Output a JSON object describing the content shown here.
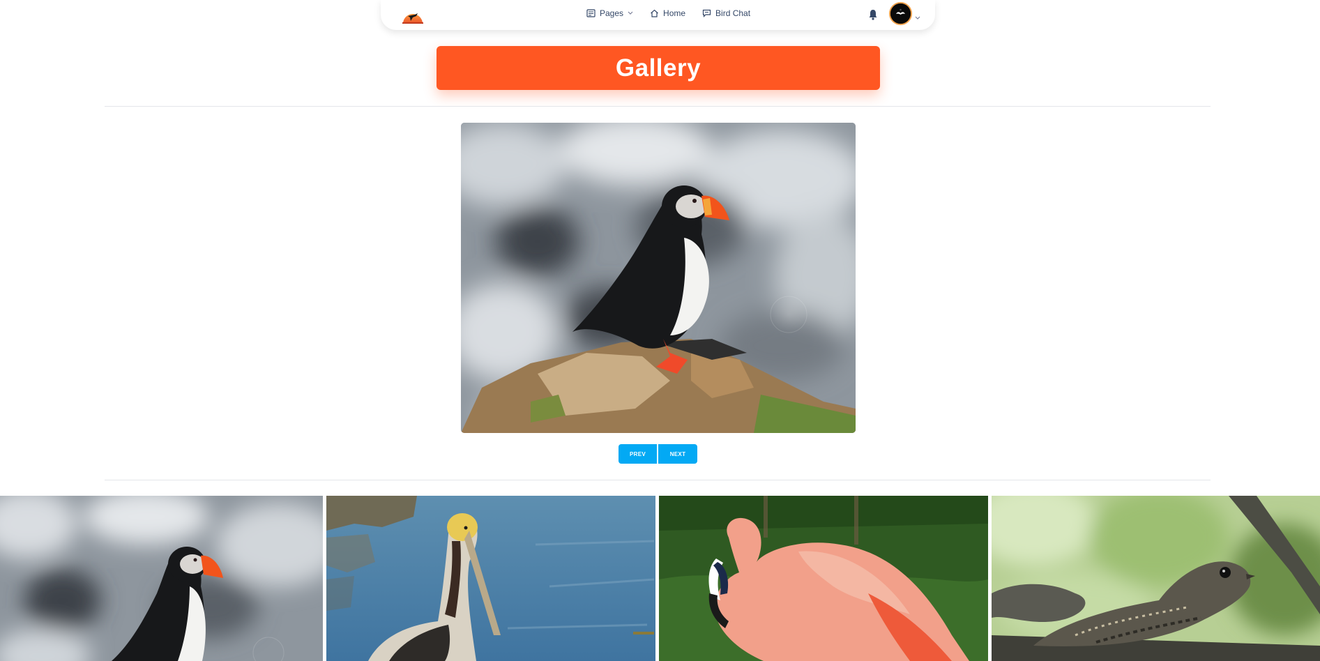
{
  "nav": {
    "pages_label": "Pages",
    "home_label": "Home",
    "chat_label": "Bird Chat"
  },
  "page": {
    "title": "Gallery"
  },
  "controls": {
    "prev_label": "PREV",
    "next_label": "NEXT"
  },
  "gallery": {
    "main_image": "puffin-photo",
    "thumbnails": [
      "puffin-photo",
      "pelican-photo",
      "flamingo-photo",
      "nightjar-photo"
    ]
  },
  "colors": {
    "title_bg": "#ff5722",
    "button_bg": "#03a9f4",
    "text": "#344767"
  }
}
